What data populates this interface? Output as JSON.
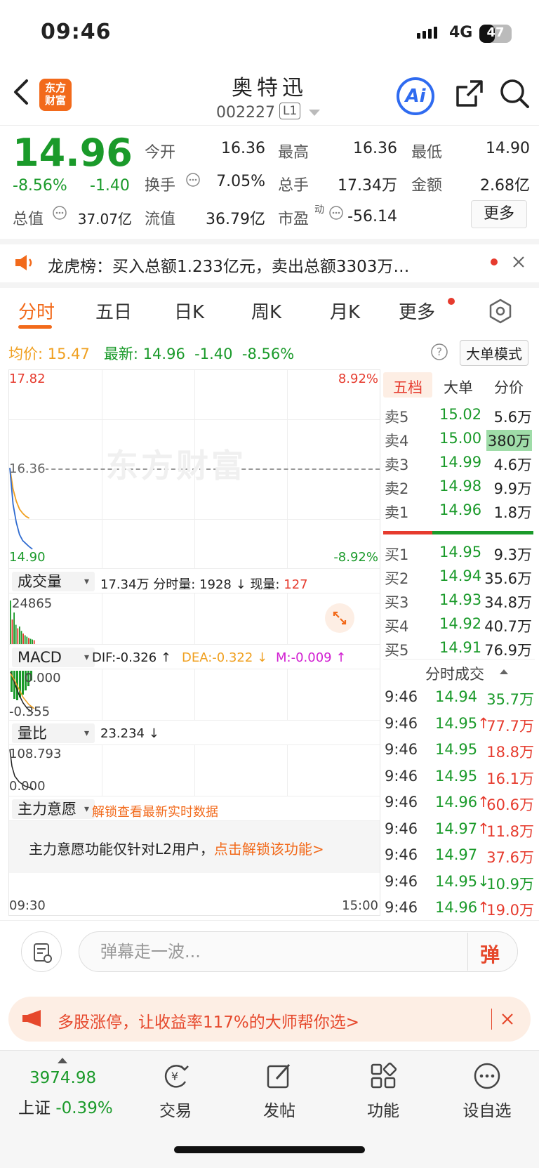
{
  "status": {
    "time": "09:46",
    "network": "4G",
    "battery": "47"
  },
  "header": {
    "title": "奥特迅",
    "code": "002227",
    "level": "L1",
    "ai": "Ai"
  },
  "quote": {
    "price": "14.96",
    "pct": "-8.56%",
    "change": "-1.40",
    "open_label": "今开",
    "open": "16.36",
    "high_label": "最高",
    "high": "16.36",
    "low_label": "最低",
    "low": "14.90",
    "turnover_label": "换手",
    "turnover": "7.05%",
    "volume_label": "总手",
    "volume": "17.34万",
    "amount_label": "金额",
    "amount": "2.68亿",
    "mktcap_label": "总值",
    "mktcap": "37.07亿",
    "float_label": "流值",
    "float": "36.79亿",
    "pe_label": "市盈",
    "pe_sup": "动",
    "pe": "-56.14",
    "more": "更多"
  },
  "notice": {
    "text": "龙虎榜：买入总额1.233亿元，卖出总额3303万…"
  },
  "tabs": [
    "分时",
    "五日",
    "日K",
    "周K",
    "月K",
    "更多"
  ],
  "avgbar": {
    "avg_label": "均价:",
    "avg": "15.47",
    "latest_label": "最新:",
    "latest": "14.96",
    "chg": "-1.40",
    "pct": "-8.56%",
    "mode": "大单模式"
  },
  "chart": {
    "top_price": "17.82",
    "mid_price": "16.36",
    "bottom_price": "14.90",
    "top_pct": "8.92%",
    "bottom_pct": "-8.92%",
    "watermark": "东方财富",
    "price_series": [
      16.3,
      15.7,
      15.4,
      15.2,
      15.1,
      15.05,
      15.0,
      14.96
    ],
    "avg_series": [
      16.3,
      15.95,
      15.75,
      15.62,
      15.55,
      15.5,
      15.47
    ],
    "start_time": "09:30",
    "end_time": "15:00"
  },
  "volume": {
    "dd": "成交量",
    "text1": "17.34万",
    "label2": "分时量:",
    "val2": "1928 ↓",
    "label3": "现量:",
    "val3": "127",
    "max": "24865",
    "bars": [
      24865,
      14000,
      18000,
      11000,
      9000,
      10000,
      7500,
      6000,
      5000,
      4200,
      3500,
      3000,
      2600,
      2200
    ]
  },
  "macd": {
    "dd": "MACD",
    "dif": "DIF:-0.326 ↑",
    "dea": "DEA:-0.322 ↓",
    "m": "M:-0.009 ↑",
    "top": "0.000",
    "bottom": "-0.355"
  },
  "ratio": {
    "dd": "量比",
    "val": "23.234 ↓",
    "top": "108.793",
    "bottom": "0.000"
  },
  "main_force": {
    "dd": "主力意愿",
    "unlock": "解锁查看最新实时数据",
    "text": "主力意愿功能仅针对L2用户，",
    "link": "点击解锁该功能>"
  },
  "orderbook": {
    "tabs": [
      "五档",
      "大单",
      "分价"
    ],
    "asks": [
      {
        "n": "卖5",
        "p": "15.02",
        "v": "5.6万"
      },
      {
        "n": "卖4",
        "p": "15.00",
        "v": "380万"
      },
      {
        "n": "卖3",
        "p": "14.99",
        "v": "4.6万"
      },
      {
        "n": "卖2",
        "p": "14.98",
        "v": "9.9万"
      },
      {
        "n": "卖1",
        "p": "14.96",
        "v": "1.8万"
      }
    ],
    "bids": [
      {
        "n": "买1",
        "p": "14.95",
        "v": "9.3万"
      },
      {
        "n": "买2",
        "p": "14.94",
        "v": "35.6万"
      },
      {
        "n": "买3",
        "p": "14.93",
        "v": "34.8万"
      },
      {
        "n": "买4",
        "p": "14.92",
        "v": "40.7万"
      },
      {
        "n": "买5",
        "p": "14.91",
        "v": "76.9万"
      }
    ],
    "trades_title": "分时成交",
    "trades": [
      {
        "t": "9:46",
        "p": "14.94",
        "a": "",
        "v": "35.7万",
        "c": "green"
      },
      {
        "t": "9:46",
        "p": "14.95",
        "a": "↑",
        "v": "77.7万",
        "c": "red"
      },
      {
        "t": "9:46",
        "p": "14.95",
        "a": "",
        "v": "18.8万",
        "c": "red"
      },
      {
        "t": "9:46",
        "p": "14.95",
        "a": "",
        "v": "16.1万",
        "c": "red"
      },
      {
        "t": "9:46",
        "p": "14.96",
        "a": "↑",
        "v": "60.6万",
        "c": "red"
      },
      {
        "t": "9:46",
        "p": "14.97",
        "a": "↑",
        "v": "11.8万",
        "c": "red"
      },
      {
        "t": "9:46",
        "p": "14.97",
        "a": "",
        "v": "37.6万",
        "c": "red"
      },
      {
        "t": "9:46",
        "p": "14.95",
        "a": "↓",
        "v": "10.9万",
        "c": "green"
      },
      {
        "t": "9:46",
        "p": "14.96",
        "a": "↑",
        "v": "19.0万",
        "c": "red"
      }
    ]
  },
  "comment": {
    "placeholder": "弹幕走一波...",
    "btn": "弹"
  },
  "promo": {
    "text": "多股涨停，让收益率117%的大师帮你选>"
  },
  "nav": {
    "index_val": "3974.98",
    "index_name": "上证",
    "index_pct": "-0.39%",
    "items": [
      "交易",
      "发帖",
      "功能",
      "设自选"
    ]
  }
}
